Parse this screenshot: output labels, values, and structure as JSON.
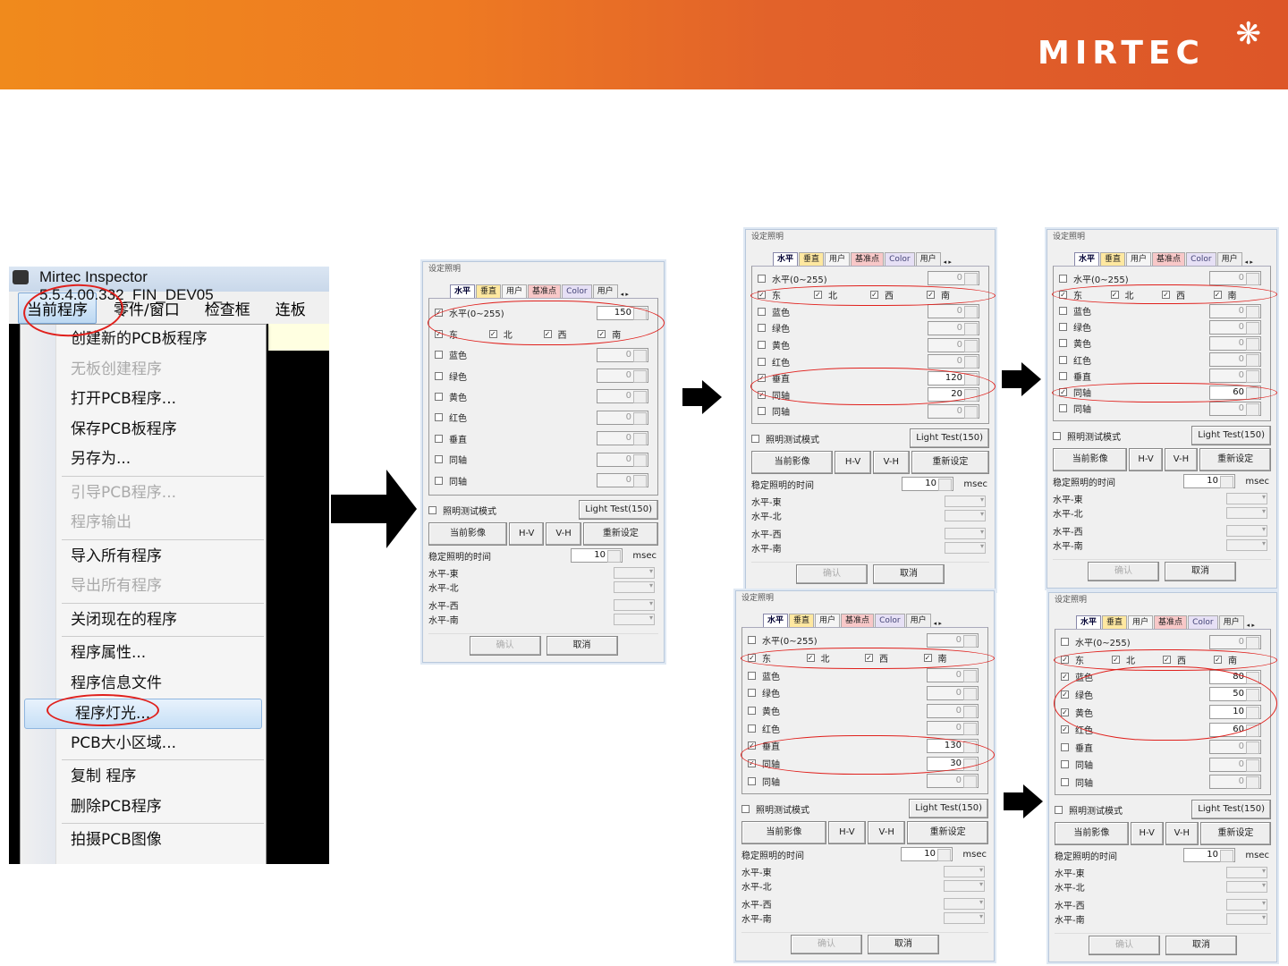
{
  "banner": {
    "logo": "MIRTEC",
    "accent": "#e8621e"
  },
  "app": {
    "title": "Mirtec Inspector 5.5.4.00.332_FIN_DEV05_",
    "menubar": [
      "当前程序",
      "零件/窗口",
      "检查框",
      "连板"
    ],
    "menu": [
      {
        "label": "创建新的PCB板程序"
      },
      {
        "label": "无板创建程序",
        "disabled": true
      },
      {
        "label": "打开PCB程序..."
      },
      {
        "label": "保存PCB板程序"
      },
      {
        "label": "另存为..."
      },
      {
        "sep": true
      },
      {
        "label": "引导PCB程序...",
        "disabled": true
      },
      {
        "label": "程序输出",
        "disabled": true
      },
      {
        "sep": true
      },
      {
        "label": "导入所有程序"
      },
      {
        "label": "导出所有程序",
        "disabled": true
      },
      {
        "sep": true
      },
      {
        "label": "关闭现在的程序"
      },
      {
        "sep": true
      },
      {
        "label": "程序属性..."
      },
      {
        "label": "程序信息文件"
      },
      {
        "label": "程序灯光...",
        "highlighted": true
      },
      {
        "label": "PCB大小区域..."
      },
      {
        "sep": true
      },
      {
        "label": "复制 程序"
      },
      {
        "label": "删除PCB程序"
      },
      {
        "sep": true
      },
      {
        "label": "拍摄PCB图像"
      },
      {
        "label": "…"
      }
    ]
  },
  "dialog_common": {
    "title": "设定照明",
    "tabs": [
      "水平",
      "垂直",
      "用户",
      "基准点",
      "Color",
      "用户"
    ],
    "horizontal_label": "水平(0~255)",
    "directions": [
      "东",
      "北",
      "西",
      "南"
    ],
    "row_labels": [
      "蓝色",
      "绿色",
      "黄色",
      "红色",
      "垂直",
      "同轴",
      "同轴"
    ],
    "test_mode": "照明测试模式",
    "light_test": "Light  Test(150)",
    "buttons": [
      "当前影像",
      "H-V",
      "V-H",
      "重新设定"
    ],
    "stable_time_label": "稳定照明的时间",
    "stable_time": "10",
    "unit": "msec",
    "combos": [
      "水平-東",
      "水平-北",
      "水平-西",
      "水平-南"
    ],
    "ok": "确认",
    "cancel": "取消"
  },
  "dialogs": [
    {
      "horizontal": {
        "checked": true,
        "value": "150"
      },
      "directions": [
        true,
        true,
        true,
        true
      ],
      "rows": [
        {
          "checked": false,
          "value": "0"
        },
        {
          "checked": false,
          "value": "0"
        },
        {
          "checked": false,
          "value": "0"
        },
        {
          "checked": false,
          "value": "0"
        },
        {
          "checked": false,
          "value": "0"
        },
        {
          "checked": false,
          "value": "0"
        },
        {
          "checked": false,
          "value": "0"
        }
      ],
      "highlight_rows": [
        [
          0,
          1
        ]
      ]
    },
    {
      "horizontal": {
        "checked": false,
        "value": "0"
      },
      "directions": [
        true,
        true,
        true,
        true
      ],
      "rows": [
        {
          "checked": false,
          "value": "0"
        },
        {
          "checked": false,
          "value": "0"
        },
        {
          "checked": false,
          "value": "0"
        },
        {
          "checked": false,
          "value": "0"
        },
        {
          "checked": true,
          "value": "120"
        },
        {
          "checked": true,
          "value": "20"
        },
        {
          "checked": false,
          "value": "0"
        }
      ],
      "highlight_rows": [
        [
          1,
          1
        ],
        [
          6,
          7
        ]
      ]
    },
    {
      "horizontal": {
        "checked": false,
        "value": "0"
      },
      "directions": [
        true,
        true,
        true,
        true
      ],
      "rows": [
        {
          "checked": false,
          "value": "0"
        },
        {
          "checked": false,
          "value": "0"
        },
        {
          "checked": false,
          "value": "0"
        },
        {
          "checked": false,
          "value": "0"
        },
        {
          "checked": false,
          "value": "0"
        },
        {
          "checked": true,
          "value": "60"
        },
        {
          "checked": false,
          "value": "0"
        }
      ],
      "highlight_rows": [
        [
          1,
          1
        ],
        [
          7,
          7
        ]
      ]
    },
    {
      "horizontal": {
        "checked": false,
        "value": "0"
      },
      "directions": [
        true,
        true,
        true,
        true
      ],
      "rows": [
        {
          "checked": false,
          "value": "0"
        },
        {
          "checked": false,
          "value": "0"
        },
        {
          "checked": false,
          "value": "0"
        },
        {
          "checked": false,
          "value": "0"
        },
        {
          "checked": true,
          "value": "130"
        },
        {
          "checked": true,
          "value": "30"
        },
        {
          "checked": false,
          "value": "0"
        }
      ],
      "highlight_rows": [
        [
          1,
          1
        ],
        [
          6,
          7
        ]
      ]
    },
    {
      "horizontal": {
        "checked": false,
        "value": "0"
      },
      "directions": [
        true,
        true,
        true,
        true
      ],
      "rows": [
        {
          "checked": true,
          "value": "80"
        },
        {
          "checked": true,
          "value": "50"
        },
        {
          "checked": true,
          "value": "10"
        },
        {
          "checked": true,
          "value": "60"
        },
        {
          "checked": false,
          "value": "0"
        },
        {
          "checked": false,
          "value": "0"
        },
        {
          "checked": false,
          "value": "0"
        }
      ],
      "highlight_rows": [
        [
          1,
          1
        ],
        [
          2,
          5
        ]
      ]
    }
  ]
}
